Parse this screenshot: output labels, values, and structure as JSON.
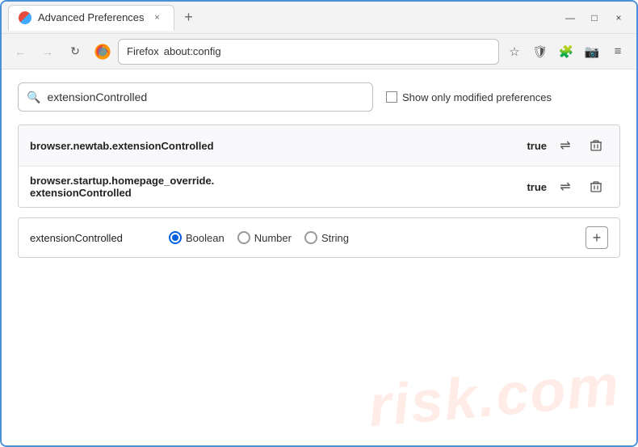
{
  "window": {
    "title": "Advanced Preferences",
    "tab_close": "×",
    "new_tab": "+",
    "minimize": "—",
    "maximize": "□",
    "close": "×"
  },
  "nav": {
    "back": "←",
    "forward": "→",
    "reload": "↻",
    "browser_name": "Firefox",
    "address": "about:config"
  },
  "nav_icons": {
    "bookmark": "☆",
    "shield": "🛡",
    "extension": "🧩",
    "screenshot": "📷",
    "more": "≡"
  },
  "search": {
    "value": "extensionControlled",
    "placeholder": "Search preference name"
  },
  "show_modified": {
    "label": "Show only modified preferences",
    "checked": false
  },
  "results": [
    {
      "name": "browser.newtab.extensionControlled",
      "value": "true"
    },
    {
      "name_line1": "browser.startup.homepage_override.",
      "name_line2": "extensionControlled",
      "value": "true"
    }
  ],
  "new_pref": {
    "name": "extensionControlled",
    "type_options": [
      {
        "label": "Boolean",
        "selected": true
      },
      {
        "label": "Number",
        "selected": false
      },
      {
        "label": "String",
        "selected": false
      }
    ],
    "add_label": "+"
  },
  "watermark": "risk.com",
  "icons": {
    "search": "🔍",
    "toggle": "⇌",
    "delete": "🗑"
  }
}
